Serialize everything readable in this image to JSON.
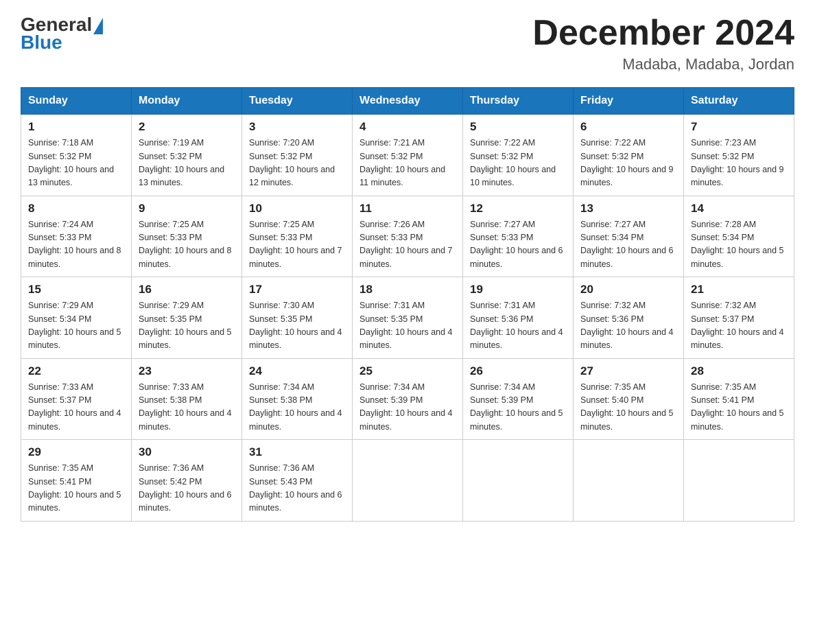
{
  "header": {
    "logo_general": "General",
    "logo_blue": "Blue",
    "title": "December 2024",
    "subtitle": "Madaba, Madaba, Jordan"
  },
  "days_of_week": [
    "Sunday",
    "Monday",
    "Tuesday",
    "Wednesday",
    "Thursday",
    "Friday",
    "Saturday"
  ],
  "weeks": [
    [
      {
        "day": "1",
        "sunrise": "7:18 AM",
        "sunset": "5:32 PM",
        "daylight": "10 hours and 13 minutes."
      },
      {
        "day": "2",
        "sunrise": "7:19 AM",
        "sunset": "5:32 PM",
        "daylight": "10 hours and 13 minutes."
      },
      {
        "day": "3",
        "sunrise": "7:20 AM",
        "sunset": "5:32 PM",
        "daylight": "10 hours and 12 minutes."
      },
      {
        "day": "4",
        "sunrise": "7:21 AM",
        "sunset": "5:32 PM",
        "daylight": "10 hours and 11 minutes."
      },
      {
        "day": "5",
        "sunrise": "7:22 AM",
        "sunset": "5:32 PM",
        "daylight": "10 hours and 10 minutes."
      },
      {
        "day": "6",
        "sunrise": "7:22 AM",
        "sunset": "5:32 PM",
        "daylight": "10 hours and 9 minutes."
      },
      {
        "day": "7",
        "sunrise": "7:23 AM",
        "sunset": "5:32 PM",
        "daylight": "10 hours and 9 minutes."
      }
    ],
    [
      {
        "day": "8",
        "sunrise": "7:24 AM",
        "sunset": "5:33 PM",
        "daylight": "10 hours and 8 minutes."
      },
      {
        "day": "9",
        "sunrise": "7:25 AM",
        "sunset": "5:33 PM",
        "daylight": "10 hours and 8 minutes."
      },
      {
        "day": "10",
        "sunrise": "7:25 AM",
        "sunset": "5:33 PM",
        "daylight": "10 hours and 7 minutes."
      },
      {
        "day": "11",
        "sunrise": "7:26 AM",
        "sunset": "5:33 PM",
        "daylight": "10 hours and 7 minutes."
      },
      {
        "day": "12",
        "sunrise": "7:27 AM",
        "sunset": "5:33 PM",
        "daylight": "10 hours and 6 minutes."
      },
      {
        "day": "13",
        "sunrise": "7:27 AM",
        "sunset": "5:34 PM",
        "daylight": "10 hours and 6 minutes."
      },
      {
        "day": "14",
        "sunrise": "7:28 AM",
        "sunset": "5:34 PM",
        "daylight": "10 hours and 5 minutes."
      }
    ],
    [
      {
        "day": "15",
        "sunrise": "7:29 AM",
        "sunset": "5:34 PM",
        "daylight": "10 hours and 5 minutes."
      },
      {
        "day": "16",
        "sunrise": "7:29 AM",
        "sunset": "5:35 PM",
        "daylight": "10 hours and 5 minutes."
      },
      {
        "day": "17",
        "sunrise": "7:30 AM",
        "sunset": "5:35 PM",
        "daylight": "10 hours and 4 minutes."
      },
      {
        "day": "18",
        "sunrise": "7:31 AM",
        "sunset": "5:35 PM",
        "daylight": "10 hours and 4 minutes."
      },
      {
        "day": "19",
        "sunrise": "7:31 AM",
        "sunset": "5:36 PM",
        "daylight": "10 hours and 4 minutes."
      },
      {
        "day": "20",
        "sunrise": "7:32 AM",
        "sunset": "5:36 PM",
        "daylight": "10 hours and 4 minutes."
      },
      {
        "day": "21",
        "sunrise": "7:32 AM",
        "sunset": "5:37 PM",
        "daylight": "10 hours and 4 minutes."
      }
    ],
    [
      {
        "day": "22",
        "sunrise": "7:33 AM",
        "sunset": "5:37 PM",
        "daylight": "10 hours and 4 minutes."
      },
      {
        "day": "23",
        "sunrise": "7:33 AM",
        "sunset": "5:38 PM",
        "daylight": "10 hours and 4 minutes."
      },
      {
        "day": "24",
        "sunrise": "7:34 AM",
        "sunset": "5:38 PM",
        "daylight": "10 hours and 4 minutes."
      },
      {
        "day": "25",
        "sunrise": "7:34 AM",
        "sunset": "5:39 PM",
        "daylight": "10 hours and 4 minutes."
      },
      {
        "day": "26",
        "sunrise": "7:34 AM",
        "sunset": "5:39 PM",
        "daylight": "10 hours and 5 minutes."
      },
      {
        "day": "27",
        "sunrise": "7:35 AM",
        "sunset": "5:40 PM",
        "daylight": "10 hours and 5 minutes."
      },
      {
        "day": "28",
        "sunrise": "7:35 AM",
        "sunset": "5:41 PM",
        "daylight": "10 hours and 5 minutes."
      }
    ],
    [
      {
        "day": "29",
        "sunrise": "7:35 AM",
        "sunset": "5:41 PM",
        "daylight": "10 hours and 5 minutes."
      },
      {
        "day": "30",
        "sunrise": "7:36 AM",
        "sunset": "5:42 PM",
        "daylight": "10 hours and 6 minutes."
      },
      {
        "day": "31",
        "sunrise": "7:36 AM",
        "sunset": "5:43 PM",
        "daylight": "10 hours and 6 minutes."
      },
      null,
      null,
      null,
      null
    ]
  ]
}
